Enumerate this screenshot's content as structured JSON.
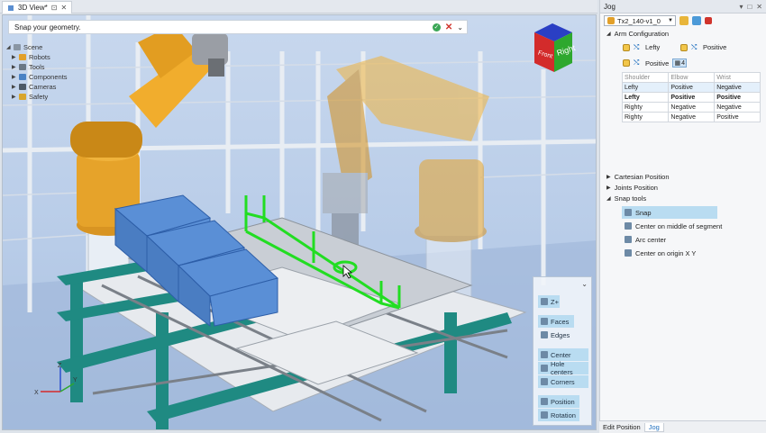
{
  "view_tab": {
    "label": "3D View*",
    "pin": "⊡",
    "close": "✕"
  },
  "hint": {
    "text": "Snap your geometry."
  },
  "scene_tree": [
    {
      "label": "Scene"
    },
    {
      "label": "Robots"
    },
    {
      "label": "Tools"
    },
    {
      "label": "Components"
    },
    {
      "label": "Cameras"
    },
    {
      "label": "Safety"
    }
  ],
  "nav_cube": {
    "front": "Front",
    "right": "Right"
  },
  "snap_palette": {
    "axis_btn": "Z+",
    "faces": "Faces",
    "edges": "Edges",
    "center": "Center",
    "hole_centers": "Hole centers",
    "corners": "Corners",
    "position": "Position",
    "rotation": "Rotation"
  },
  "axis_labels": {
    "x": "X",
    "y": "Y",
    "z": "Z"
  },
  "jog": {
    "title": "Jog",
    "robot": "Tx2_140-v1_0",
    "arm_config": {
      "label": "Arm Configuration",
      "lefty": "Lefty",
      "positive1": "Positive",
      "positive2": "Positive",
      "solutions": "4"
    },
    "table": {
      "headers": [
        "Shoulder",
        "Elbow",
        "Wrist"
      ],
      "rows": [
        [
          "Lefty",
          "Positive",
          "Negative"
        ],
        [
          "Lefty",
          "Positive",
          "Positive"
        ],
        [
          "Righty",
          "Negative",
          "Negative"
        ],
        [
          "Righty",
          "Negative",
          "Positive"
        ]
      ]
    },
    "cartesian": "Cartesian Position",
    "joints": "Joints Position",
    "snap_tools": "Snap tools",
    "snap_items": [
      "Snap",
      "Center on middle of segment",
      "Arc center",
      "Center on origin X Y"
    ]
  },
  "bottom_tabs": {
    "edit_position": "Edit Position",
    "jog": "Jog"
  }
}
